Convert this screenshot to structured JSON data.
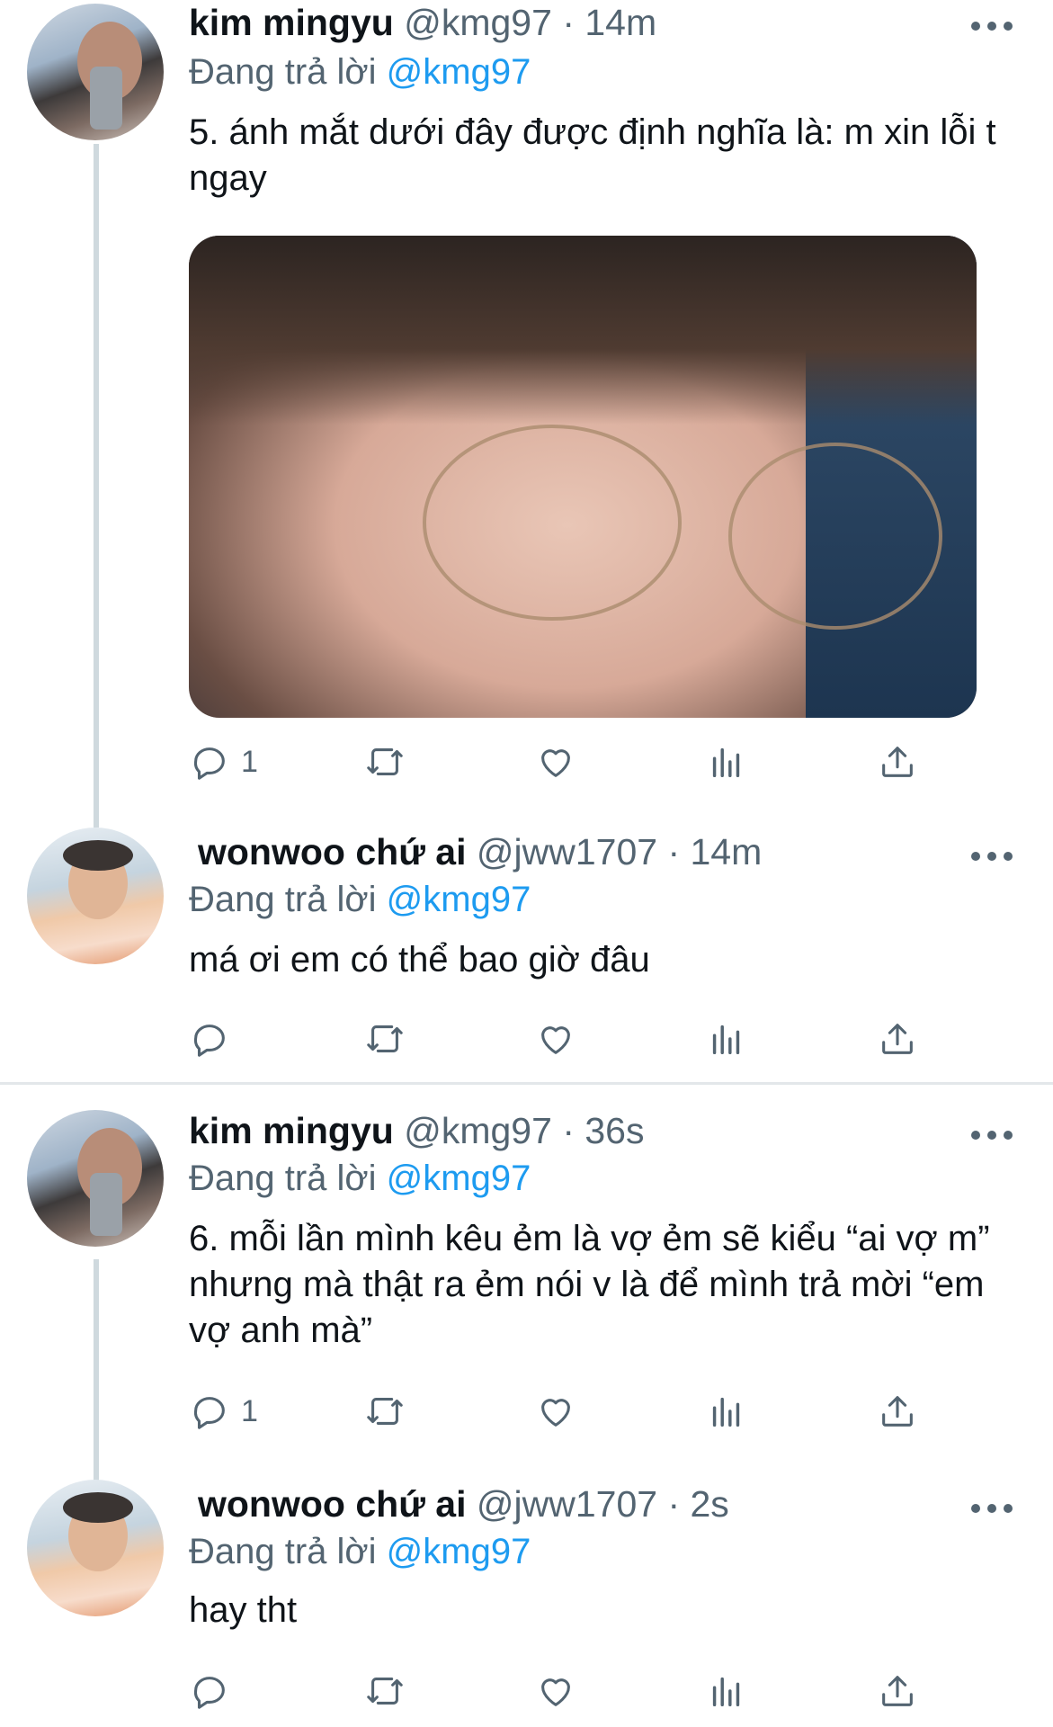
{
  "tweets": [
    {
      "author": "kim mingyu",
      "handle": "@kmg97",
      "time": "· 14m",
      "replying_prefix": "Đang trả lời",
      "replying_to": "@kmg97",
      "text": "5. ánh mắt dưới đây được định nghĩa là: m xin lỗi t ngay",
      "reply_count": "1"
    },
    {
      "author": "wonwoo chứ ai",
      "handle": "@jww1707",
      "time": "· 14m",
      "replying_prefix": "Đang trả lời",
      "replying_to": "@kmg97",
      "text": "má ơi em có thể bao giờ đâu",
      "reply_count": ""
    },
    {
      "author": "kim mingyu",
      "handle": "@kmg97",
      "time": "· 36s",
      "replying_prefix": "Đang trả lời",
      "replying_to": "@kmg97",
      "text": "6. mỗi lần mình kêu ẻm là vợ ẻm sẽ kiểu “ai vợ m” nhưng mà thật ra ẻm nói v là để mình trả mời “em vợ anh mà”",
      "reply_count": "1"
    },
    {
      "author": "wonwoo chứ ai",
      "handle": "@jww1707",
      "time": "· 2s",
      "replying_prefix": "Đang trả lời",
      "replying_to": "@kmg97",
      "text": "hay tht",
      "reply_count": ""
    }
  ],
  "icons": [
    "reply-icon",
    "retweet-icon",
    "like-icon",
    "views-icon",
    "share-icon",
    "more-icon"
  ],
  "colors": {
    "mention": "#1d9bf0",
    "secondary": "#536471",
    "thread_line": "#cfd9de"
  }
}
